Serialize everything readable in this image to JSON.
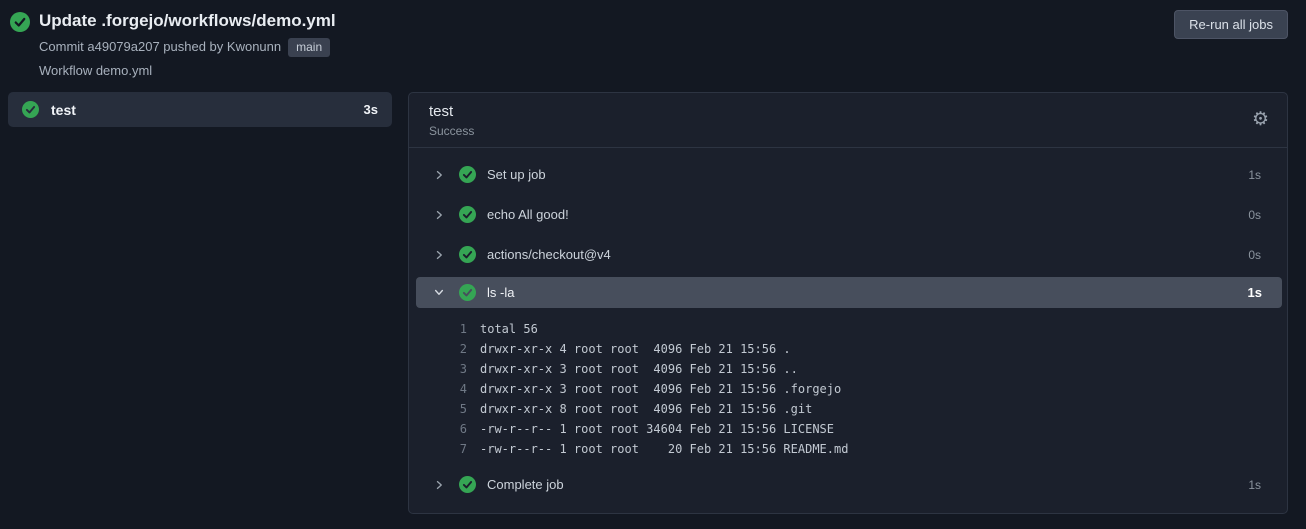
{
  "colors": {
    "success_green": "#35a554",
    "page_bg": "#131822",
    "panel_bg": "#1b202c",
    "selected_row_bg": "#474e5c"
  },
  "header": {
    "title": "Update .forgejo/workflows/demo.yml",
    "commit_text": "Commit a49079a207 pushed by Kwonunn",
    "branch_badge": "main",
    "workflow_text": "Workflow demo.yml",
    "rerun_button_label": "Re-run all jobs"
  },
  "sidebar": {
    "jobs": [
      {
        "name": "test",
        "duration": "3s",
        "status": "success",
        "selected": true
      }
    ]
  },
  "panel": {
    "job_title": "test",
    "job_status": "Success",
    "steps": [
      {
        "label": "Set up job",
        "duration": "1s",
        "status": "success",
        "expanded": false
      },
      {
        "label": "echo All good!",
        "duration": "0s",
        "status": "success",
        "expanded": false
      },
      {
        "label": "actions/checkout@v4",
        "duration": "0s",
        "status": "success",
        "expanded": false
      },
      {
        "label": "ls -la",
        "duration": "1s",
        "status": "success",
        "expanded": true
      },
      {
        "label": "Complete job",
        "duration": "1s",
        "status": "success",
        "expanded": false
      }
    ],
    "log": {
      "lines": [
        {
          "num": "1",
          "text": "total 56"
        },
        {
          "num": "2",
          "text": "drwxr-xr-x 4 root root  4096 Feb 21 15:56 ."
        },
        {
          "num": "3",
          "text": "drwxr-xr-x 3 root root  4096 Feb 21 15:56 .."
        },
        {
          "num": "4",
          "text": "drwxr-xr-x 3 root root  4096 Feb 21 15:56 .forgejo"
        },
        {
          "num": "5",
          "text": "drwxr-xr-x 8 root root  4096 Feb 21 15:56 .git"
        },
        {
          "num": "6",
          "text": "-rw-r--r-- 1 root root 34604 Feb 21 15:56 LICENSE"
        },
        {
          "num": "7",
          "text": "-rw-r--r-- 1 root root    20 Feb 21 15:56 README.md"
        }
      ]
    }
  }
}
